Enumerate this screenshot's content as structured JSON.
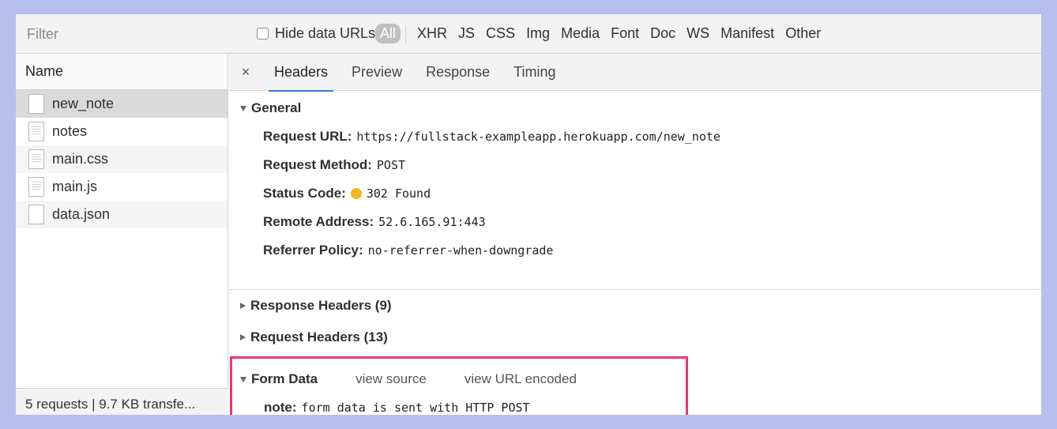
{
  "filterbar": {
    "filter_placeholder": "Filter",
    "hide_data_urls": "Hide data URLs",
    "types": [
      "All",
      "XHR",
      "JS",
      "CSS",
      "Img",
      "Media",
      "Font",
      "Doc",
      "WS",
      "Manifest",
      "Other"
    ]
  },
  "requests": {
    "header": "Name",
    "files": [
      {
        "name": "new_note"
      },
      {
        "name": "notes"
      },
      {
        "name": "main.css"
      },
      {
        "name": "main.js"
      },
      {
        "name": "data.json"
      }
    ],
    "status": "5 requests | 9.7 KB transfe..."
  },
  "tabs": {
    "close": "×",
    "items": [
      "Headers",
      "Preview",
      "Response",
      "Timing"
    ]
  },
  "general": {
    "title": "General",
    "request_url_label": "Request URL:",
    "request_url": "https://fullstack-exampleapp.herokuapp.com/new_note",
    "request_method_label": "Request Method:",
    "request_method": "POST",
    "status_code_label": "Status Code:",
    "status_code": "302 Found",
    "remote_address_label": "Remote Address:",
    "remote_address": "52.6.165.91:443",
    "referrer_policy_label": "Referrer Policy:",
    "referrer_policy": "no-referrer-when-downgrade"
  },
  "response_headers": "Response Headers (9)",
  "request_headers": "Request Headers (13)",
  "form_data": {
    "title": "Form Data",
    "view_source": "view source",
    "view_url_encoded": "view URL encoded",
    "key": "note:",
    "value": "form data is sent with HTTP POST"
  },
  "colors": {
    "background": "#b7bfee",
    "highlight_border": "#e8396d",
    "status_dot": "#f2b81c",
    "active_tab": "#3879d9"
  }
}
